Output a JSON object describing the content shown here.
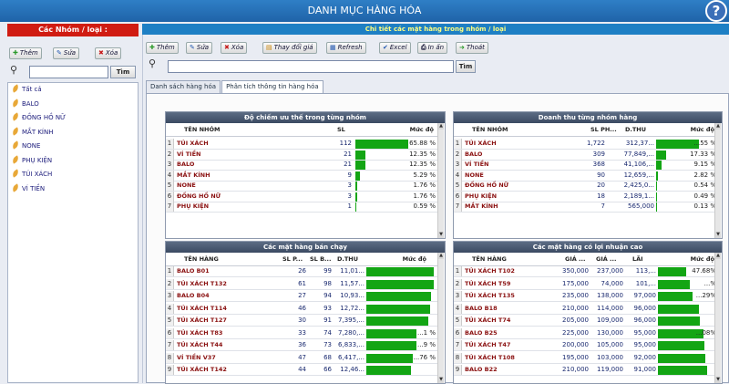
{
  "window": {
    "title": "DANH MỤC HÀNG HÓA",
    "help": "?"
  },
  "left": {
    "header": "Các Nhóm / loại :",
    "buttons": {
      "add": "Thêm",
      "edit": "Sửa",
      "delete": "Xóa"
    },
    "search_button": "Tìm",
    "tree": [
      "Tất cả",
      "BALO",
      "ĐỒNG HỒ NỮ",
      "MẮT KÍNH",
      "NONE",
      "PHỤ KIỆN",
      "TÚI XÁCH",
      "VÍ TIỀN"
    ]
  },
  "right": {
    "header": "Chi tiết các mặt hàng trong nhóm / loại",
    "toolbar": {
      "add": "Thêm",
      "edit": "Sửa",
      "delete": "Xóa",
      "price": "Thay đổi giá",
      "refresh": "Refresh",
      "excel": "Excel",
      "print": "In ấn",
      "exit": "Thoát"
    },
    "search_button": "Tìm",
    "tabs": [
      "Danh sách hàng hóa",
      "Phân tích thông tin hàng hóa"
    ]
  },
  "panels": {
    "group_share": {
      "title": "Độ chiếm ưu thế trong từng nhóm",
      "headers": [
        "TÊN NHÓM",
        "SL",
        "Mức độ"
      ],
      "rows": [
        {
          "i": "1",
          "name": "TÚI XÁCH",
          "sl": "112",
          "pct": "65.88 %",
          "v": 0.6588
        },
        {
          "i": "2",
          "name": "VÍ TIỀN",
          "sl": "21",
          "pct": "12.35 %",
          "v": 0.1235
        },
        {
          "i": "3",
          "name": "BALO",
          "sl": "21",
          "pct": "12.35 %",
          "v": 0.1235
        },
        {
          "i": "4",
          "name": "MẮT KÍNH",
          "sl": "9",
          "pct": "5.29 %",
          "v": 0.0529
        },
        {
          "i": "5",
          "name": "NONE",
          "sl": "3",
          "pct": "1.76 %",
          "v": 0.0176
        },
        {
          "i": "6",
          "name": "ĐỒNG HỒ NỮ",
          "sl": "3",
          "pct": "1.76 %",
          "v": 0.0176
        },
        {
          "i": "7",
          "name": "PHỤ KIỆN",
          "sl": "1",
          "pct": "0.59 %",
          "v": 0.0059
        }
      ]
    },
    "group_revenue": {
      "title": "Doanh thu từng nhóm hàng",
      "headers": [
        "TÊN NHÓM",
        "SL PH...",
        "D.THU",
        "Mức độ"
      ],
      "rows": [
        {
          "i": "1",
          "name": "TÚI XÁCH",
          "sl": "1,722",
          "dt": "312,37...",
          "pct": "...55 %",
          "v": 0.7155
        },
        {
          "i": "2",
          "name": "BALO",
          "sl": "309",
          "dt": "77,849,...",
          "pct": "17.33 %",
          "v": 0.1733
        },
        {
          "i": "3",
          "name": "VÍ TIỀN",
          "sl": "368",
          "dt": "41,106,...",
          "pct": "9.15 %",
          "v": 0.0915
        },
        {
          "i": "4",
          "name": "NONE",
          "sl": "90",
          "dt": "12,659,...",
          "pct": "2.82 %",
          "v": 0.0282
        },
        {
          "i": "5",
          "name": "ĐỒNG HỒ NỮ",
          "sl": "20",
          "dt": "2,425,0...",
          "pct": "0.54 %",
          "v": 0.0054
        },
        {
          "i": "6",
          "name": "PHỤ KIỆN",
          "sl": "18",
          "dt": "2,189,1...",
          "pct": "0.49 %",
          "v": 0.0049
        },
        {
          "i": "7",
          "name": "MẮT KÍNH",
          "sl": "7",
          "dt": "565,000",
          "pct": "0.13 %",
          "v": 0.0013
        }
      ]
    },
    "best_sellers": {
      "title": "Các mặt hàng bán chạy",
      "headers": [
        "TÊN HÀNG",
        "SL P...",
        "SL B...",
        "D.THU",
        "Mức độ"
      ],
      "rows": [
        {
          "i": "1",
          "name": "BALO B01",
          "a": "26",
          "b": "99",
          "c": "11,01...",
          "pct": "",
          "v": 0.98
        },
        {
          "i": "2",
          "name": "TÚI XÁCH T132",
          "a": "61",
          "b": "98",
          "c": "11,57...",
          "pct": "",
          "v": 0.97
        },
        {
          "i": "3",
          "name": "BALO B04",
          "a": "27",
          "b": "94",
          "c": "10,93...",
          "pct": "",
          "v": 0.93
        },
        {
          "i": "4",
          "name": "TÚI XÁCH T114",
          "a": "46",
          "b": "93",
          "c": "12,72...",
          "pct": "",
          "v": 0.92
        },
        {
          "i": "5",
          "name": "TÚI XÁCH T127",
          "a": "30",
          "b": "91",
          "c": "7,395,...",
          "pct": "",
          "v": 0.9
        },
        {
          "i": "6",
          "name": "TÚI XÁCH T83",
          "a": "33",
          "b": "74",
          "c": "7,280,...",
          "pct": "...1 %",
          "v": 0.73
        },
        {
          "i": "7",
          "name": "TÚI XÁCH T44",
          "a": "36",
          "b": "73",
          "c": "6,833,...",
          "pct": "...9 %",
          "v": 0.72
        },
        {
          "i": "8",
          "name": "VÍ TIỀN V37",
          "a": "47",
          "b": "68",
          "c": "6,417,...",
          "pct": "...76 %",
          "v": 0.67
        },
        {
          "i": "9",
          "name": "TÚI XÁCH T142",
          "a": "44",
          "b": "66",
          "c": "12,46...",
          "pct": "",
          "v": 0.65
        }
      ]
    },
    "high_profit": {
      "title": "Các mặt hàng có lợi nhuận cao",
      "headers": [
        "TÊN HÀNG",
        "GIÁ ...",
        "GIÁ ...",
        "LÃI",
        "Mức độ"
      ],
      "rows": [
        {
          "i": "1",
          "name": "TÚI XÁCH T102",
          "a": "350,000",
          "b": "237,000",
          "c": "113,...",
          "pct": "47.68%",
          "v": 0.4768
        },
        {
          "i": "2",
          "name": "TÚI XÁCH T59",
          "a": "175,000",
          "b": "74,000",
          "c": "101,...",
          "pct": "...%",
          "v": 0.55
        },
        {
          "i": "3",
          "name": "TÚI XÁCH T135",
          "a": "235,000",
          "b": "138,000",
          "c": "97,000",
          "pct": "...29%",
          "v": 0.6
        },
        {
          "i": "4",
          "name": "BALO B18",
          "a": "210,000",
          "b": "114,000",
          "c": "96,000",
          "pct": "",
          "v": 0.7
        },
        {
          "i": "5",
          "name": "TÚI XÁCH T74",
          "a": "205,000",
          "b": "109,000",
          "c": "96,000",
          "pct": "",
          "v": 0.72
        },
        {
          "i": "6",
          "name": "BALO B25",
          "a": "225,000",
          "b": "130,000",
          "c": "95,000",
          "pct": "...08%",
          "v": 0.78
        },
        {
          "i": "7",
          "name": "TÚI XÁCH T47",
          "a": "200,000",
          "b": "105,000",
          "c": "95,000",
          "pct": "",
          "v": 0.8
        },
        {
          "i": "8",
          "name": "TÚI XÁCH T108",
          "a": "195,000",
          "b": "103,000",
          "c": "92,000",
          "pct": "",
          "v": 0.82
        },
        {
          "i": "9",
          "name": "BALO B22",
          "a": "210,000",
          "b": "119,000",
          "c": "91,000",
          "pct": "",
          "v": 0.84
        }
      ]
    }
  },
  "colors": {
    "title": "#1f63a8",
    "left_header": "#d01c12",
    "right_header": "#1e7fc4",
    "bar": "#13a514"
  }
}
